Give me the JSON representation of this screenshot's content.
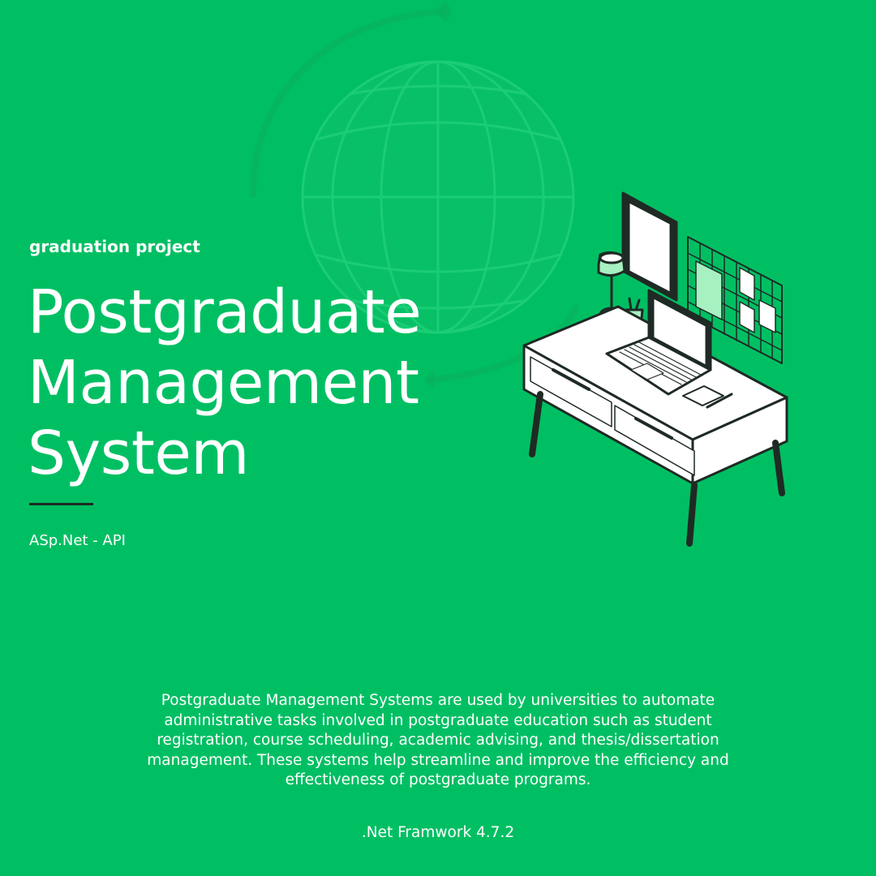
{
  "eyebrow": "graduation project",
  "title_lines": [
    "Postgraduate",
    "Management",
    "System"
  ],
  "subtitle": "ASp.Net - API",
  "description": "Postgraduate Management Systems are used by universities to automate administrative tasks involved in postgraduate education such as student registration, course scheduling, academic advising, and thesis/dissertation management. These systems help streamline and improve the efficiency and effectiveness of postgraduate programs.",
  "framework": ".Net Framwork 4.7.2",
  "colors": {
    "background": "#00bf63",
    "accent_dark": "#1f2a24",
    "accent_light": "#a7f0c0"
  },
  "icons": {
    "background": "globe-icon",
    "illustration": "desk-workspace-illustration"
  }
}
